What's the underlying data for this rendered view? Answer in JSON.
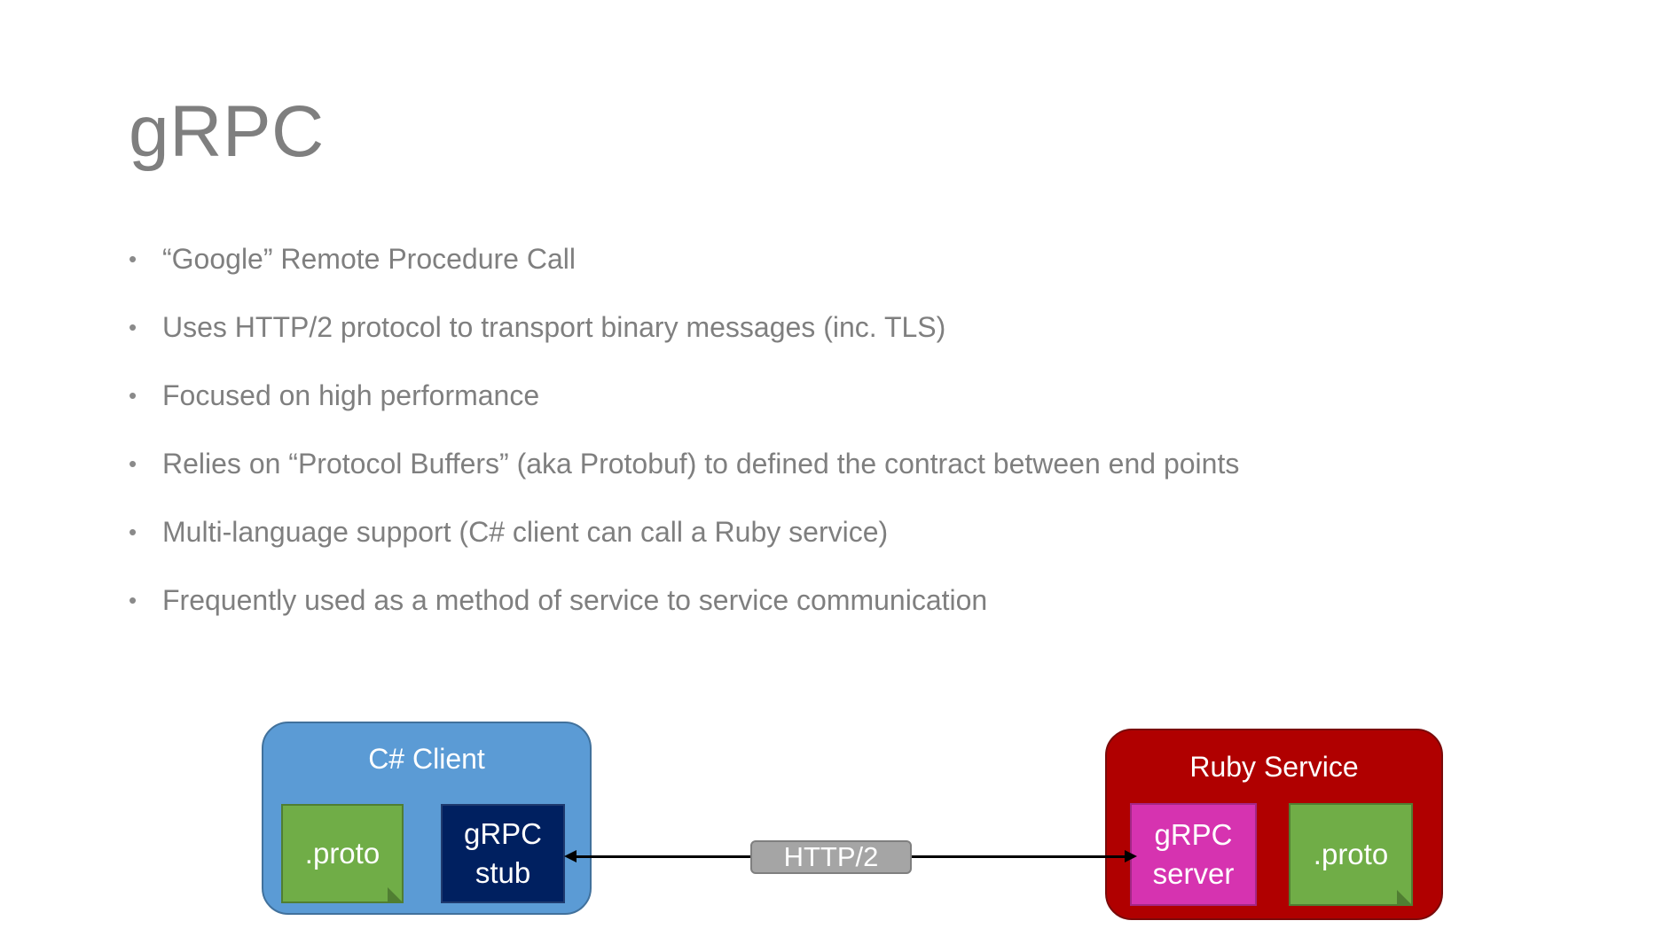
{
  "title": "gRPC",
  "bullets": [
    "“Google” Remote Procedure Call",
    "Uses HTTP/2 protocol to transport binary messages (inc. TLS)",
    "Focused on high performance",
    "Relies on “Protocol Buffers” (aka Protobuf) to defined the contract between end points",
    "Multi-language support (C# client can call a Ruby service)",
    "Frequently used as a method of service to service communication"
  ],
  "bullet_symbol": "•",
  "diagram": {
    "client": {
      "title": "C# Client",
      "proto_label": ".proto",
      "stub_line1": "gRPC",
      "stub_line2": "stub",
      "color": "#5b9bd5"
    },
    "service": {
      "title": "Ruby Service",
      "server_line1": "gRPC",
      "server_line2": "server",
      "proto_label": ".proto",
      "color": "#b00000"
    },
    "connection_label": "HTTP/2",
    "colors": {
      "proto": "#70ad47",
      "stub": "#002060",
      "server": "#d633b0",
      "connection_label_bg": "#a5a5a5"
    }
  }
}
